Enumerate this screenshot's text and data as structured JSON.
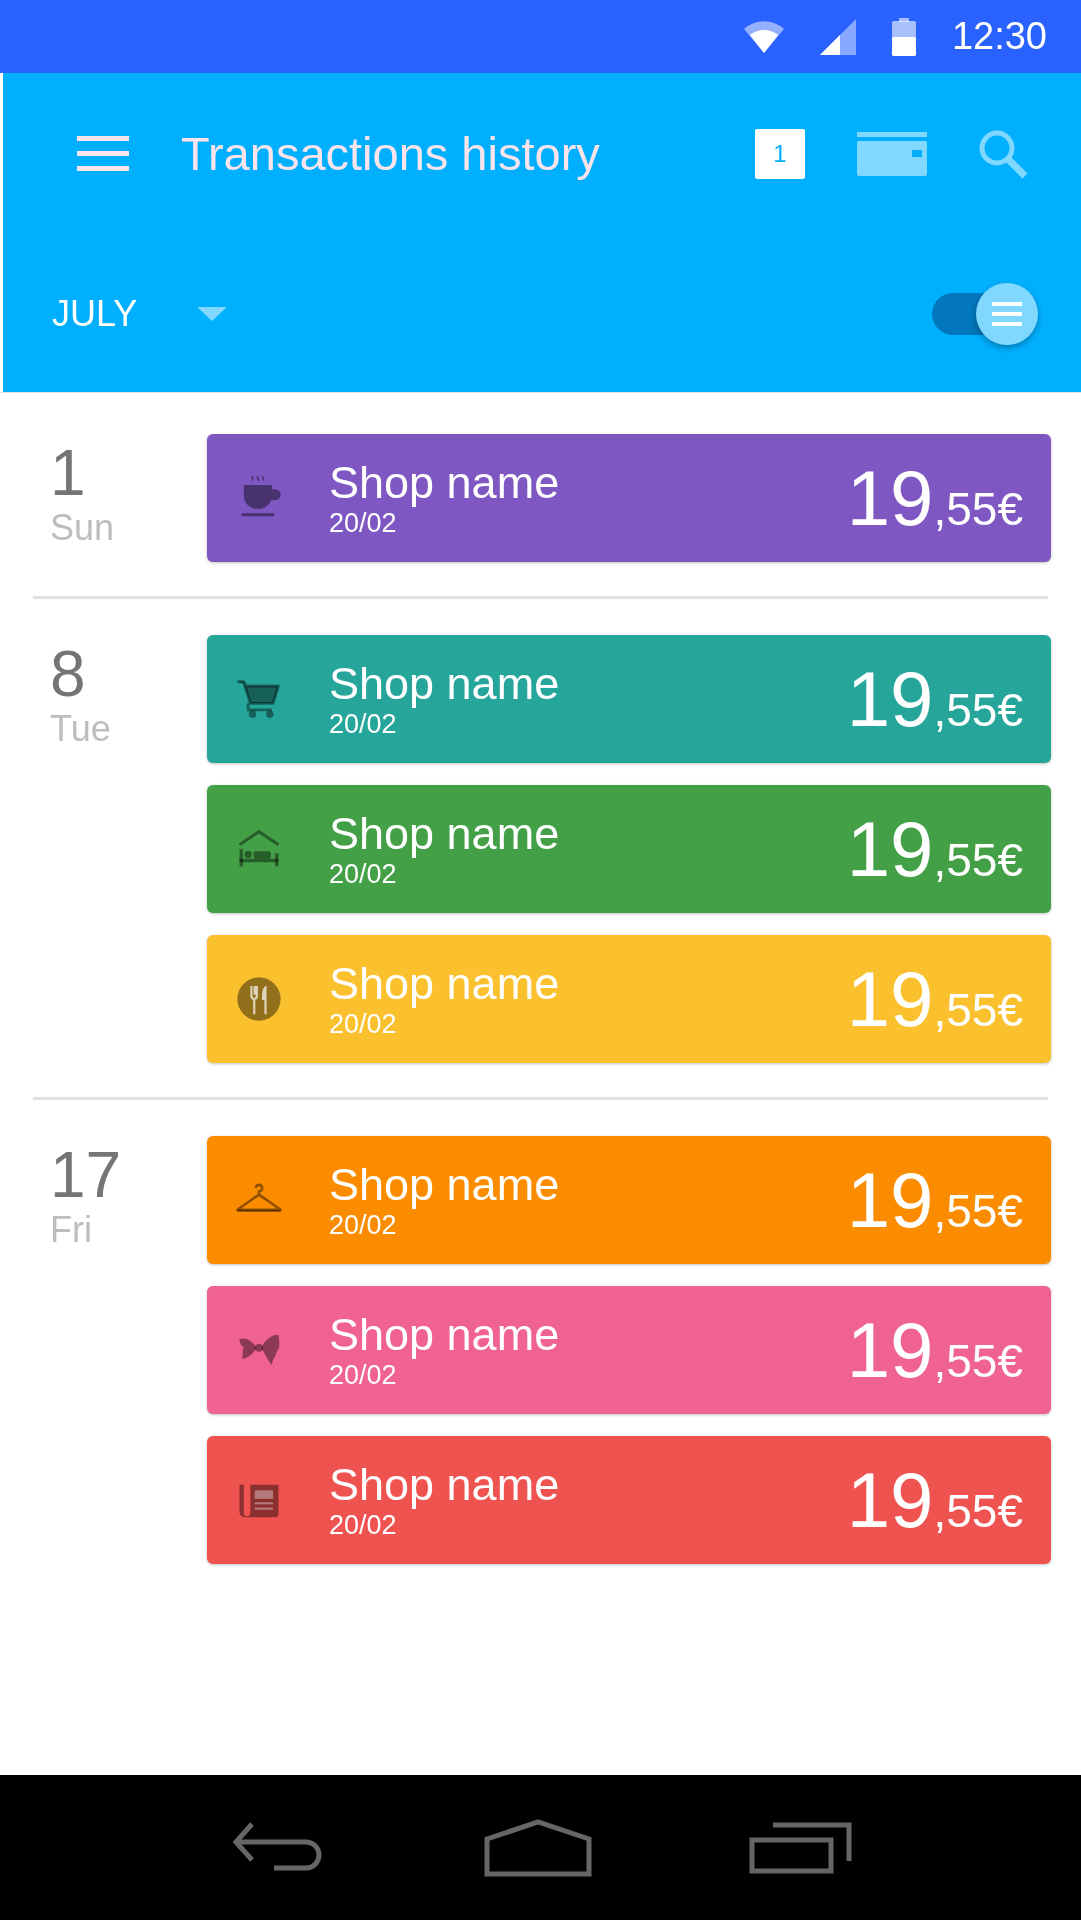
{
  "status_bar": {
    "time": "12:30"
  },
  "toolbar": {
    "title": "Transactions history",
    "calendar_day": "1"
  },
  "filter": {
    "month": "JULY",
    "toggle": {
      "on": true
    }
  },
  "groups": [
    {
      "day": "1",
      "weekday": "Sun",
      "transactions": [
        {
          "kind": "coffee",
          "color": "#7e57c2",
          "shop": "Shop name",
          "date": "20/02",
          "amount_whole": "19",
          "amount_fraction": ",55€"
        }
      ]
    },
    {
      "day": "8",
      "weekday": "Tue",
      "transactions": [
        {
          "kind": "shopping",
          "color": "#26a69a",
          "shop": "Shop name",
          "date": "20/02",
          "amount_whole": "19",
          "amount_fraction": ",55€"
        },
        {
          "kind": "hotel",
          "color": "#43a047",
          "shop": "Shop name",
          "date": "20/02",
          "amount_whole": "19",
          "amount_fraction": ",55€"
        },
        {
          "kind": "restaurant",
          "color": "#fbc02d",
          "shop": "Shop name",
          "date": "20/02",
          "amount_whole": "19",
          "amount_fraction": ",55€"
        }
      ]
    },
    {
      "day": "17",
      "weekday": "Fri",
      "transactions": [
        {
          "kind": "clothes",
          "color": "#fb8c00",
          "shop": "Shop name",
          "date": "20/02",
          "amount_whole": "19",
          "amount_fraction": ",55€"
        },
        {
          "kind": "pasta",
          "color": "#f06292",
          "shop": "Shop name",
          "date": "20/02",
          "amount_whole": "19",
          "amount_fraction": ",55€"
        },
        {
          "kind": "news",
          "color": "#ef5350",
          "shop": "Shop name",
          "date": "20/02",
          "amount_whole": "19",
          "amount_fraction": ",55€"
        }
      ]
    }
  ]
}
